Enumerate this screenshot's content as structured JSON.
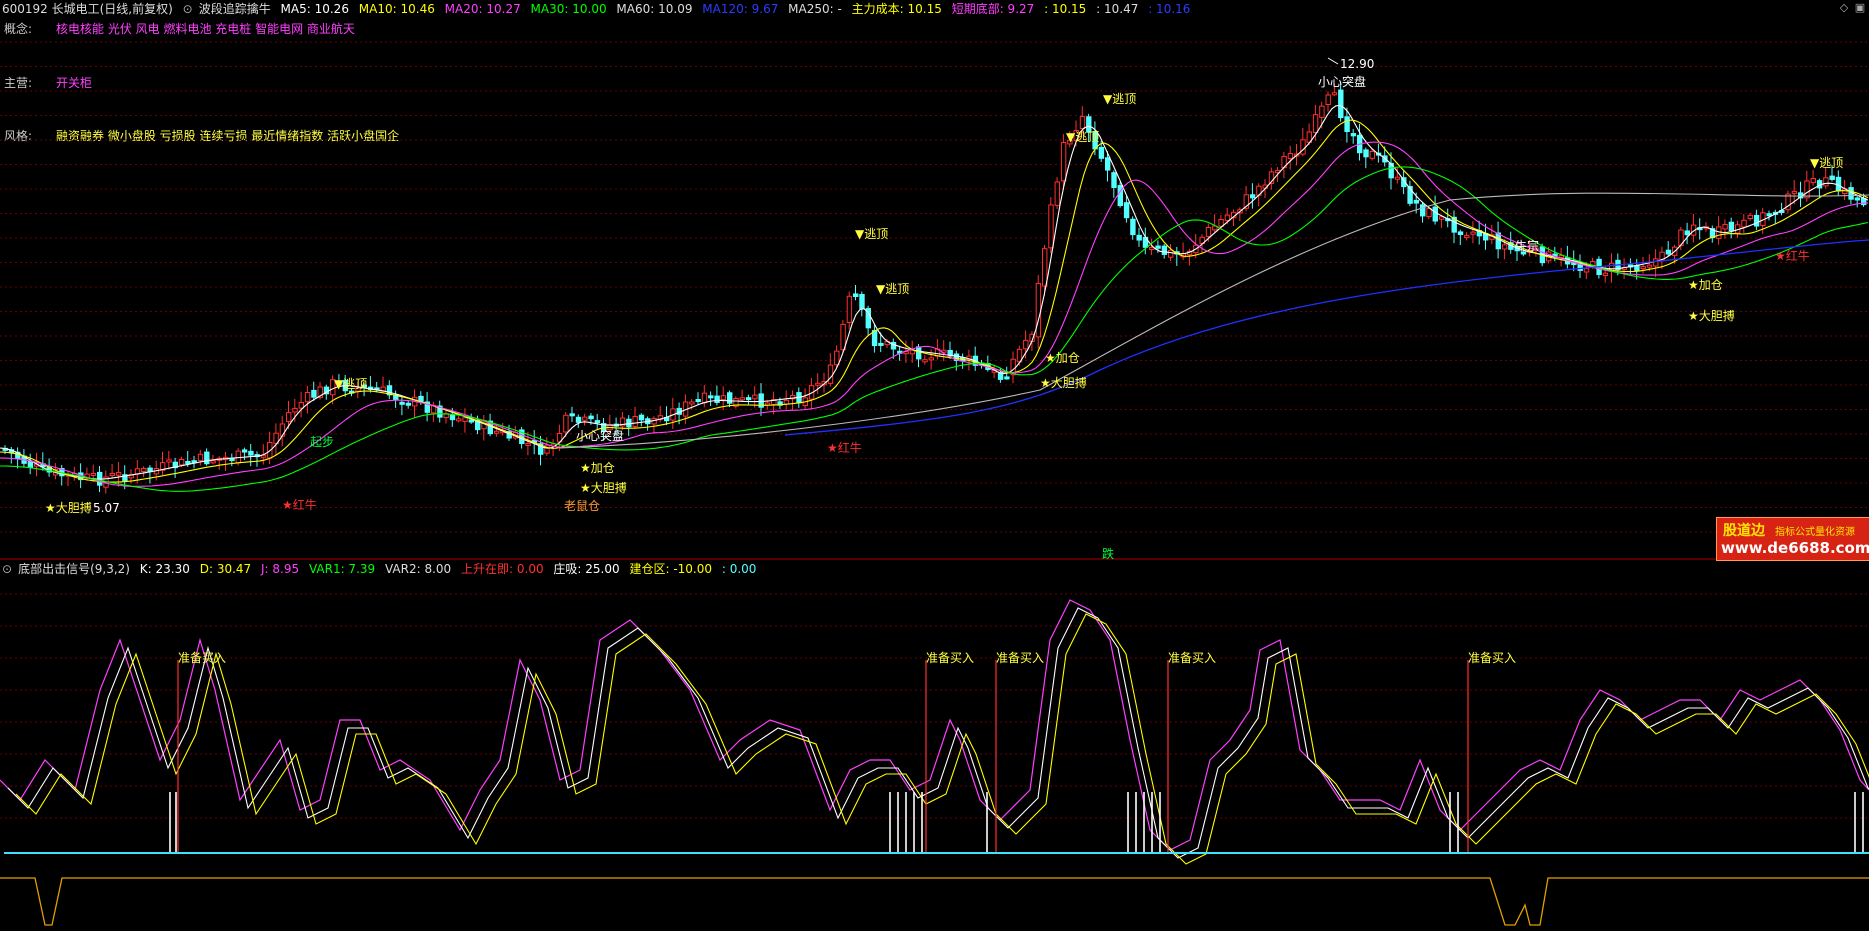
{
  "header": {
    "stock": "600192 长城电工(日线,前复权)",
    "formula": "波段追踪擒牛",
    "ma5": "MA5: 10.26",
    "ma10": "MA10: 10.46",
    "ma20": "MA20: 10.27",
    "ma30": "MA30: 10.00",
    "ma60": "MA60: 10.09",
    "ma120": "MA120: 9.67",
    "ma250": "MA250: -",
    "cost": "主力成本: 10.15",
    "bottom": "短期底部: 9.27",
    "v1": ": 10.15",
    "v2": ": 10.47",
    "v3": ": 10.16"
  },
  "info": {
    "concept_label": "概念:",
    "concept_value": "核电核能 光伏 风电 燃料电池 充电桩 智能电网 商业航天",
    "main_label": "主营:",
    "main_value": "开关柜",
    "style_label": "风格:",
    "style_value": "融资融券 微小盘股 亏损股 连续亏损 最近情绪指数 活跃小盘国企"
  },
  "annotations": {
    "escape": "▼逃顶",
    "add": "★加仓",
    "bold": "★大胆搏",
    "red_bull": "★红牛",
    "careful": "小心突盘",
    "old_rat": "老鼠仓",
    "high": "12.90",
    "low": "5.07",
    "fall": "跌",
    "start": "起步",
    "bull": "牛宗"
  },
  "indicator": {
    "name": "底部出击信号(9,3,2)",
    "k": "K: 23.30",
    "d": "D: 30.47",
    "j": "J: 8.95",
    "var1": "VAR1: 7.39",
    "var2": "VAR2: 8.00",
    "up": "上升在即: 0.00",
    "absorb": "庄吸: 25.00",
    "build": "建仓区: -10.00",
    "last": ": 0.00",
    "ready_buy": "准备买入"
  },
  "watermark": {
    "brand": "股道边",
    "tagline": "指标公式量化资源",
    "url": "www.de6688.com"
  },
  "colors": {
    "up": "#ff3030",
    "down": "#54ffff",
    "ma5": "#ffffff",
    "ma10": "#ffff00",
    "ma20": "#ff40ff",
    "ma30": "#00ff00",
    "ma60": "#bbbbbb",
    "ma120": "#2030ff"
  }
}
